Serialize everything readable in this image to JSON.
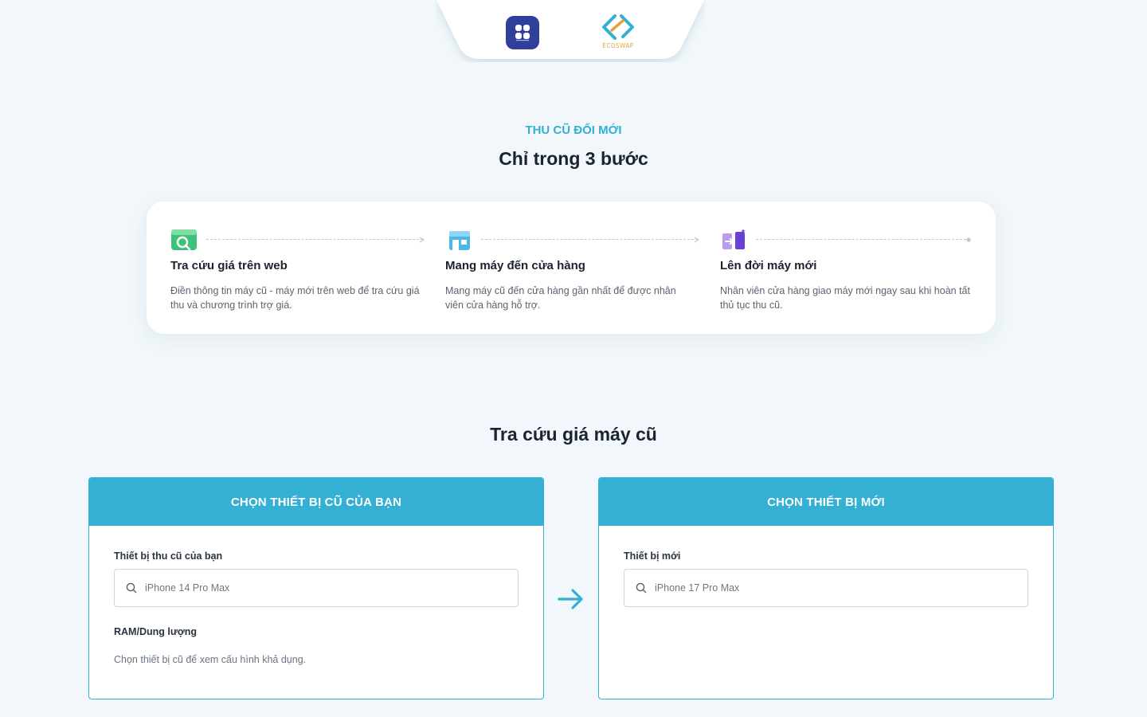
{
  "brand": {
    "left_logo": "app-grid-logo",
    "right_logo": "ecoswap-logo",
    "ecoswap_text": "ECOSWAP"
  },
  "steps_section": {
    "eyebrow": "THU CŨ ĐỔI MỚI",
    "title": "Chỉ trong 3 bước",
    "steps": [
      {
        "icon": "search-price-icon",
        "title": "Tra cứu giá trên web",
        "description": "Điền thông tin máy cũ - máy mới trên web để tra cứu giá thu và chương trình trợ giá."
      },
      {
        "icon": "store-icon",
        "title": "Mang máy đến cửa hàng",
        "description": "Mang máy cũ đến cửa hàng gần nhất để được nhân viên cửa hàng hỗ trợ."
      },
      {
        "icon": "swap-device-icon",
        "title": "Lên đời máy mới",
        "description": "Nhân viên cửa hàng giao máy mới ngay sau khi hoàn tất thủ tục thu cũ."
      }
    ]
  },
  "lookup": {
    "title": "Tra cứu giá máy cũ",
    "old_panel": {
      "header": "CHỌN THIẾT BỊ CŨ CỦA BẠN",
      "device_label": "Thiết bị thu cũ của bạn",
      "device_placeholder": "iPhone 14 Pro Max",
      "ram_label": "RAM/Dung lượng",
      "ram_hint": "Chọn thiết bị cũ để xem cấu hình khả dụng."
    },
    "new_panel": {
      "header": "CHỌN THIẾT BỊ MỚI",
      "device_label": "Thiết bị mới",
      "device_placeholder": "iPhone 17 Pro Max"
    }
  },
  "colors": {
    "accent": "#33b0d3",
    "background": "#f1f7fa",
    "brand_app": "#2f3f9a",
    "ecoswap_gold": "#e3a33a"
  }
}
